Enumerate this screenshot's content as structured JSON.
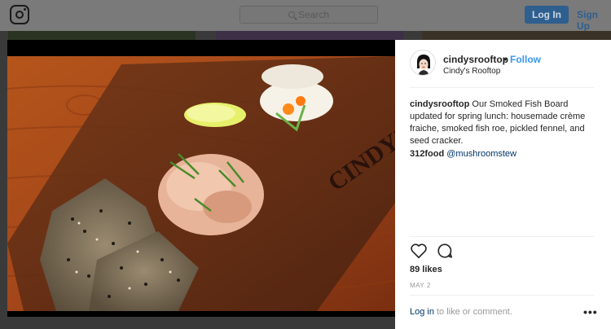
{
  "nav": {
    "search_placeholder": "Search",
    "login_button": "Log In",
    "signup_link": "Sign Up"
  },
  "post": {
    "username": "cindysrooftop",
    "bullet": "•",
    "follow_label": "Follow",
    "location": "Cindy's Rooftop",
    "caption_user": "cindysrooftop",
    "caption_text": "Our Smoked Fish Board updated for spring lunch: housemade crème fraiche, smoked fish roe, pickled fennel, and seed cracker.",
    "tag_1": "312food",
    "tag_2": "@mushroomstew",
    "likes": "89 likes",
    "date": "MAY 2",
    "login_label": "Log in",
    "login_suffix": " to like or comment.",
    "more_label": "•••",
    "board_brand": "CINDY'S"
  },
  "icons": {
    "instagram": "instagram-logo-icon",
    "search": "search-icon",
    "heart": "heart-icon",
    "comment": "comment-icon",
    "more": "more-options-icon"
  }
}
